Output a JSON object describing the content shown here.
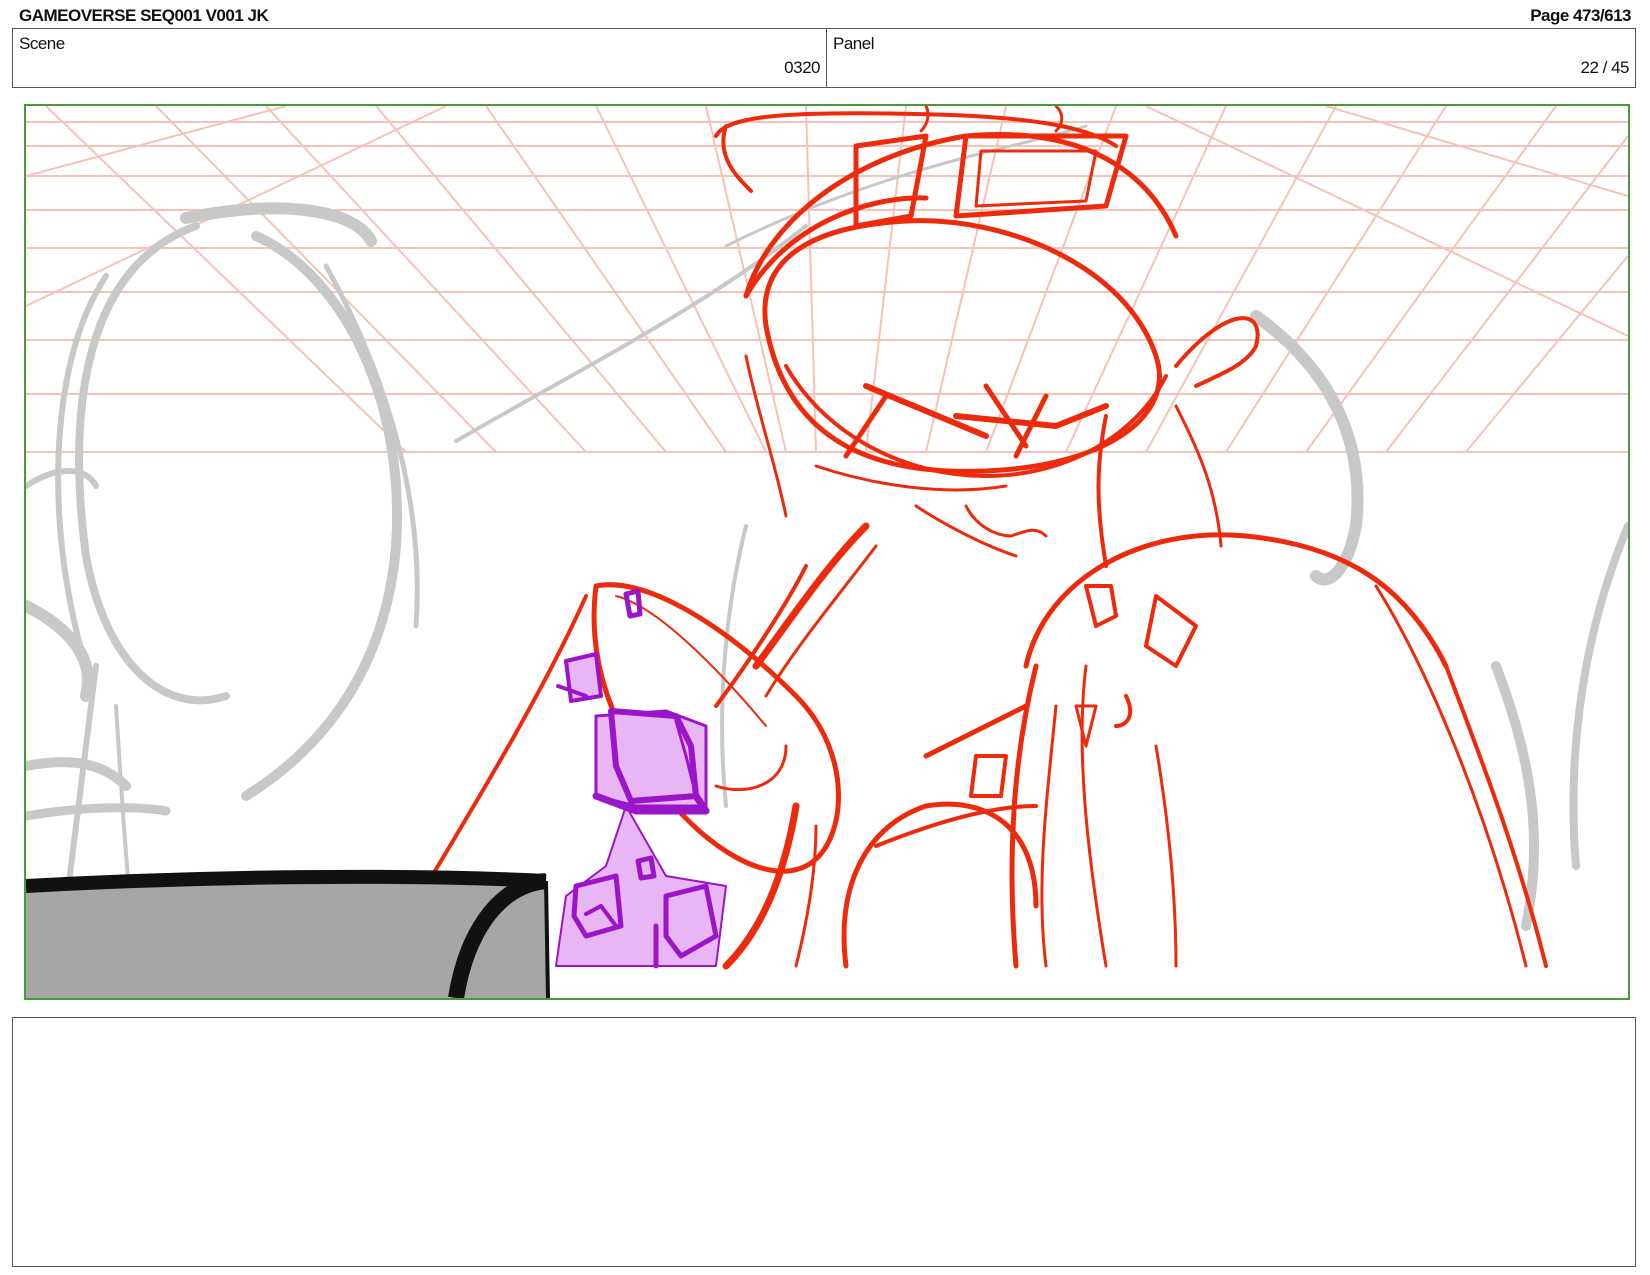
{
  "header": {
    "title": "GAMEOVERSE SEQ001 V001 JK",
    "page": "Page 473/613"
  },
  "scene": {
    "label": "Scene",
    "value": "0320"
  },
  "panel": {
    "label": "Panel",
    "value": "22 / 45"
  },
  "frame": {
    "border_color": "#4a9a3c",
    "colors": {
      "grid": "#f6c2b8",
      "rough_sketch": "#c8c8c8",
      "character_lines": "#ee2a0c",
      "prop_fill": "#e9b6f5",
      "prop_lines": "#9a14c8",
      "foreground_fill": "#a6a6a6",
      "foreground_lines": "#111111"
    }
  },
  "notes": {
    "text": ""
  }
}
